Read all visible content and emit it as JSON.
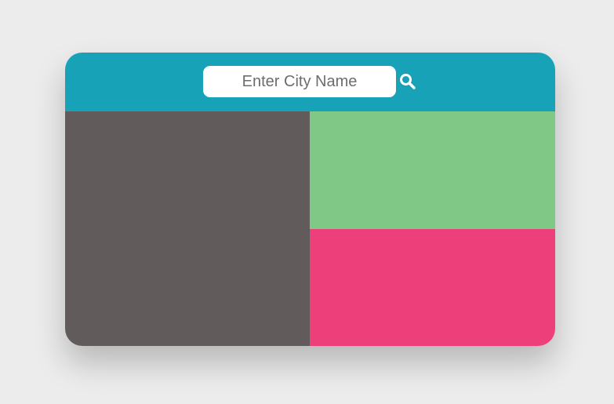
{
  "search": {
    "placeholder": "Enter City Name",
    "value": "",
    "icon": "search-icon"
  },
  "colors": {
    "page_background": "#ececec",
    "header": "#17a2b8",
    "left_panel": "#625b5c",
    "right_top_panel": "#80c886",
    "right_bottom_panel": "#ed3f7a",
    "icon": "#ffffff"
  }
}
